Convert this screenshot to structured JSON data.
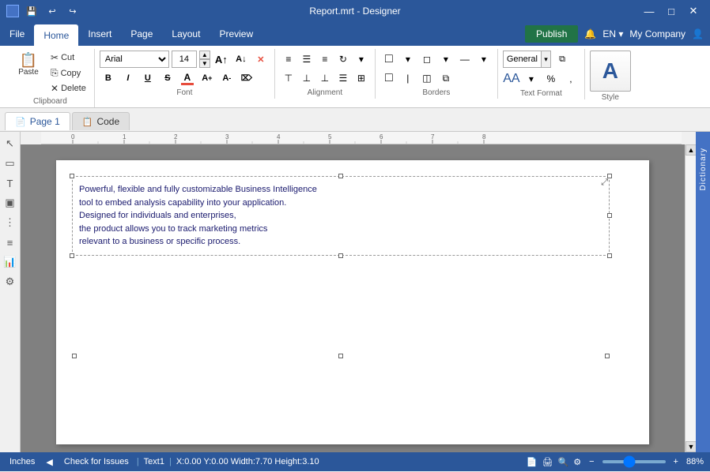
{
  "titleBar": {
    "title": "Report.mrt - Designer",
    "saveIcon": "💾",
    "undoIcon": "↩",
    "redoIcon": "↪",
    "minimizeIcon": "—",
    "maximizeIcon": "□",
    "closeIcon": "✕"
  },
  "menuBar": {
    "items": [
      "File",
      "Home",
      "Insert",
      "Page",
      "Layout",
      "Preview"
    ],
    "activeItem": "Home",
    "rightItems": [
      "Publish",
      "🔔",
      "EN ▾",
      "My Company",
      "👤"
    ]
  },
  "ribbon": {
    "clipboard": {
      "label": "Clipboard",
      "paste": "Paste",
      "cut": "Cut",
      "copy": "Copy",
      "delete": "Delete"
    },
    "font": {
      "label": "Font",
      "family": "Arial",
      "size": "14",
      "bold": "B",
      "italic": "I",
      "underline": "U",
      "strikethrough": "S",
      "fontColorA": "A",
      "shrink": "A↓",
      "grow": "A↑",
      "clearFormat": "✕"
    },
    "alignment": {
      "label": "Alignment",
      "alignLeft": "≡",
      "alignCenter": "≡",
      "alignRight": "≡",
      "rotate": "↻",
      "moreAlign": "▾",
      "topAlign": "⊤",
      "midAlign": "⊥",
      "bottomAlign": "⊥",
      "indent": "≡",
      "moreOpts": "⊞"
    },
    "borders": {
      "label": "Borders",
      "borderBtn": "□",
      "fillBtn": "◻",
      "lineBtn": "—",
      "moreBtn": "▾"
    },
    "textFormat": {
      "label": "Text Format",
      "generalLabel": "General",
      "moreBtn": "▾",
      "expandBtn": "⧉"
    },
    "style": {
      "label": "Style",
      "icon": "A"
    }
  },
  "tabs": [
    {
      "id": "page",
      "label": "Page 1",
      "icon": "📄",
      "active": true
    },
    {
      "id": "code",
      "label": "Code",
      "icon": "📋",
      "active": false
    }
  ],
  "leftToolbar": {
    "tools": [
      "↖",
      "▭",
      "T",
      "▣",
      "⋮⋮",
      "≡",
      "📊",
      "🔧"
    ]
  },
  "page": {
    "content": "Powerful, flexible and fully customizable Business Intelligence\ntool to embed analysis capability into your application.\nDesigned for individuals and enterprises,\nthe product allows you to track marketing metrics\nrelevant to a business or specific process."
  },
  "statusBar": {
    "inchesLabel": "Inches",
    "checkLabel": "Check for Issues",
    "textField": "Text1",
    "coords": "X:0.00  Y:0.00  Width:7.70  Height:3.10",
    "zoomLevel": "88%",
    "zoomMinus": "−",
    "zoomPlus": "+"
  },
  "rightPanel": {
    "label": "Dictionary"
  }
}
